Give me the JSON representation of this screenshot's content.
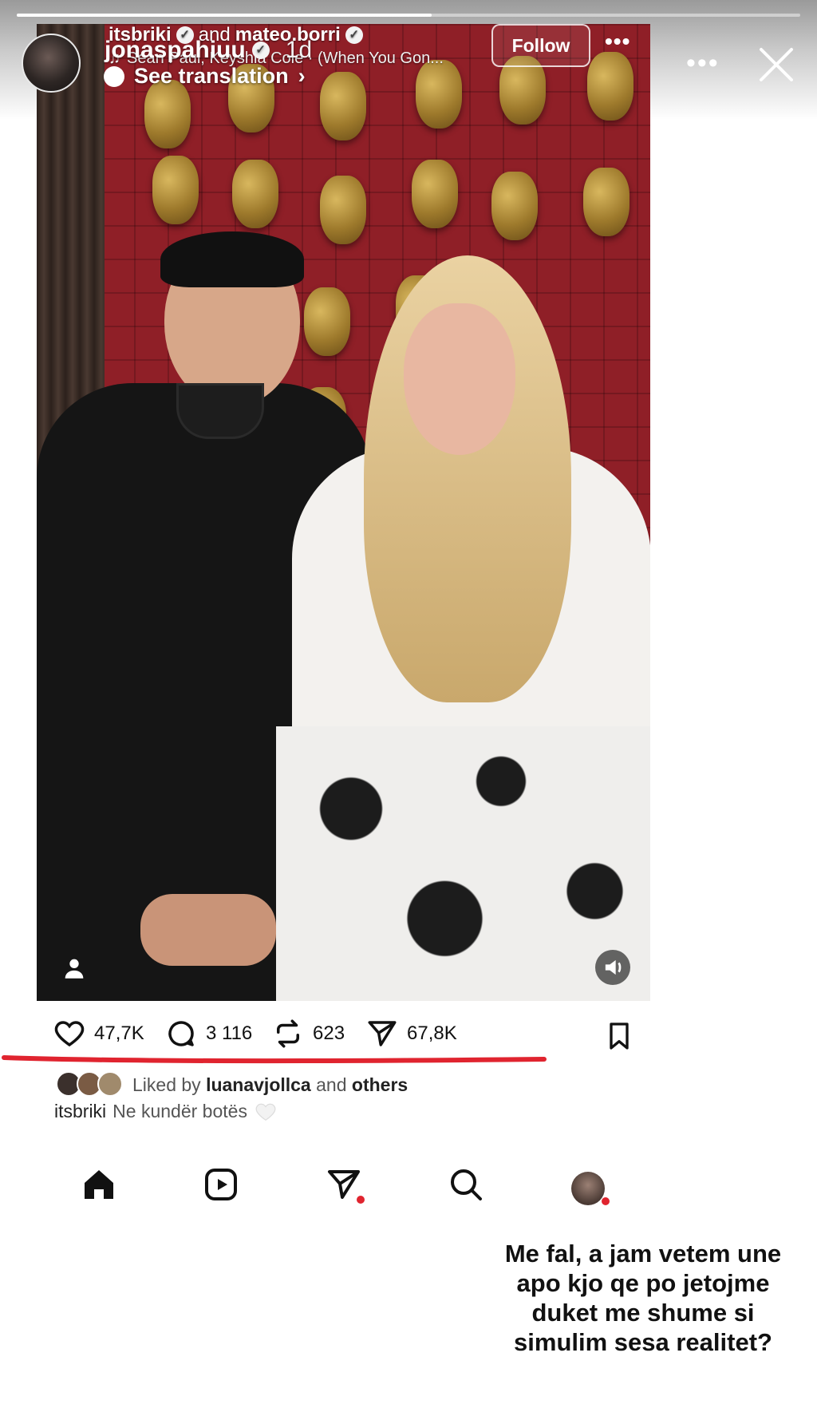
{
  "story": {
    "username": "jonaspahiuu",
    "time": "1d",
    "progress_fraction": 0.53,
    "more_label": "•••",
    "caption": "Me fal, a jam vetem une apo kjo qe po jetojme duket me shume si simulim sesa realitet?"
  },
  "post": {
    "author_1": "itsbriki",
    "and_label": "and",
    "author_2": "mateo.borri",
    "audio": "Sean Paul, Keyshia Cole · (When You Gon...",
    "follow_label": "Follow",
    "more_label": "•••",
    "see_translation_label": "See translation",
    "likes": "47,7K",
    "comments": "3 116",
    "reposts": "623",
    "shares": "67,8K",
    "liked_by_prefix": "Liked by",
    "liked_by_user": "luanavjollca",
    "liked_by_and": "and",
    "liked_by_others": "others",
    "caption_user": "itsbriki",
    "caption_text": "Ne kundër botës"
  },
  "icons": {
    "like": "heart-icon",
    "comment": "comment-icon",
    "repost": "repost-icon",
    "share": "send-icon",
    "save": "bookmark-icon",
    "nav": [
      "home-icon",
      "reels-icon",
      "send-icon",
      "search-icon",
      "profile-avatar"
    ]
  },
  "colors": {
    "underline": "#e0242f",
    "notification_dot": "#e0242f",
    "wall": "#8f1f27"
  }
}
